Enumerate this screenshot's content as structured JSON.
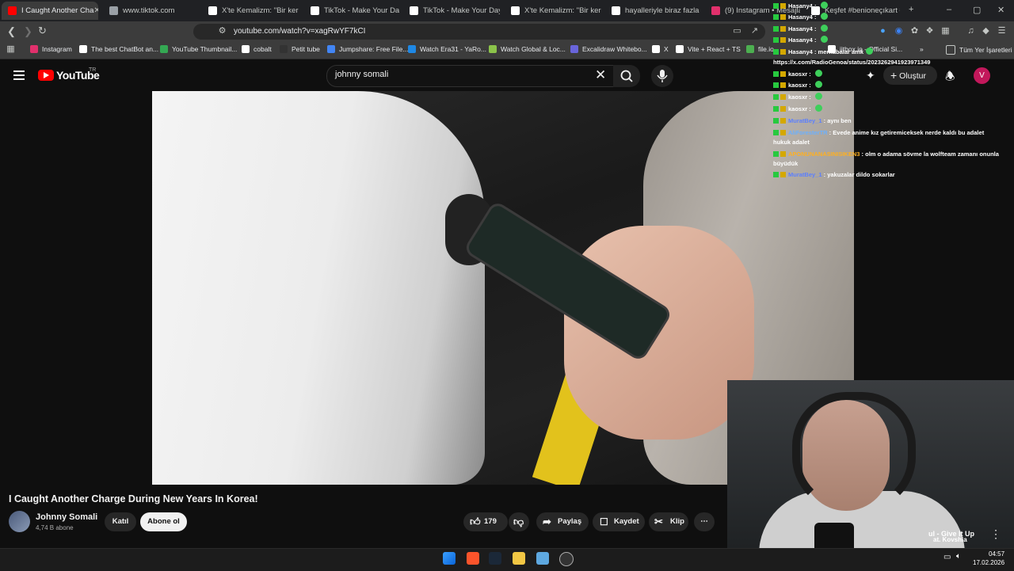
{
  "browser": {
    "tabs": [
      {
        "label": "I Caught Another Cha",
        "color": "#ff0000",
        "active": true
      },
      {
        "label": "www.tiktok.com",
        "color": "#9aa0a6"
      },
      {
        "label": "X'te Kemalizm: \"Bir kere d",
        "color": "#ffffff"
      },
      {
        "label": "TikTok - Make Your Day",
        "color": "#ffffff"
      },
      {
        "label": "TikTok - Make Your Day",
        "color": "#ffffff"
      },
      {
        "label": "X'te Kemalizm: \"Bir kere d",
        "color": "#ffffff"
      },
      {
        "label": "hayalleriyle biraz fazla oy",
        "color": "#ffffff"
      },
      {
        "label": "(9) Instagram • Mesajlar",
        "color": "#e1306c"
      },
      {
        "label": "Keşfet #benioneçıkart #k",
        "color": "#ffffff"
      }
    ],
    "new_tab": "+",
    "window_controls": [
      "–",
      "▢",
      "✕"
    ],
    "url": "youtube.com/watch?v=xagRwYF7kCI",
    "bookmarks": [
      {
        "label": "Instagram",
        "color": "#e1306c"
      },
      {
        "label": "The best ChatBot an...",
        "color": "#ffffff"
      },
      {
        "label": "YouTube Thumbnail...",
        "color": "#34a853"
      },
      {
        "label": "cobalt",
        "color": "#ffffff"
      },
      {
        "label": "Petit tube",
        "color": "#333333"
      },
      {
        "label": "Jumpshare: Free File...",
        "color": "#4285f4"
      },
      {
        "label": "Watch Era31 - YaRo...",
        "color": "#1e88e5"
      },
      {
        "label": "Watch Global & Loc...",
        "color": "#8bc34a"
      },
      {
        "label": "Excalidraw Whitebo...",
        "color": "#6965db"
      },
      {
        "label": "X",
        "color": "#ffffff"
      },
      {
        "label": "Vite + React + TS",
        "color": "#ffffff"
      },
      {
        "label": "file.io",
        "color": "#4caf50"
      },
      {
        "label": "jitbox.io - Official Si...",
        "color": "#ffffff"
      }
    ],
    "more_bookmarks": "»",
    "all_bookmarks": "Tüm Yer İşaretleri"
  },
  "youtube": {
    "logo": "YouTube",
    "country": "TR",
    "search_value": "johnny somali",
    "create_label": "Oluştur",
    "avatar_letter": "V",
    "video_title": "I Caught Another Charge During New Years In Korea!",
    "channel_name": "Johnny Somali",
    "subscribers": "4,74 B abone",
    "join_label": "Katıl",
    "subscribe_label": "Abone ol",
    "likes": "179",
    "share_label": "Paylaş",
    "save_label": "Kaydet",
    "clip_label": "Klip"
  },
  "chat": {
    "lines": [
      {
        "user": "Hasany4",
        "msg": "",
        "ucolor": "#ffffff",
        "emote": true
      },
      {
        "user": "Hasany4",
        "msg": "",
        "ucolor": "#ffffff",
        "emote": true
      },
      {
        "user": "Hasany4",
        "msg": "",
        "ucolor": "#ffffff",
        "emote": true
      },
      {
        "user": "Hasany4",
        "msg": "",
        "ucolor": "#ffffff",
        "emote": true
      },
      {
        "user": "Hasany4",
        "msg": "merhabalar amk",
        "ucolor": "#ffffff",
        "emote": true
      },
      {
        "user": "",
        "msg": "https://x.com/RadioGenoa/status/2023262941923971349",
        "ucolor": "#ffffff",
        "emote": false
      },
      {
        "user": "kaosxr",
        "msg": "",
        "ucolor": "#ffffff",
        "emote": true
      },
      {
        "user": "kaosxr",
        "msg": "",
        "ucolor": "#ffffff",
        "emote": true
      },
      {
        "user": "kaosxr",
        "msg": "",
        "ucolor": "#ffffff",
        "emote": true
      },
      {
        "user": "kaosxr",
        "msg": "",
        "ucolor": "#ffffff",
        "emote": true
      },
      {
        "user": "MuratBey_1",
        "msg": "aynı ben",
        "ucolor": "#5b7fff",
        "emote": false
      },
      {
        "user": "AliForesterTR",
        "msg": "Evede anime kız getiremiceksek nerde kaldı bu adalet",
        "ucolor": "#6ab0ff",
        "emote": false
      },
      {
        "user": "",
        "msg": "hukuk adalet",
        "ucolor": "#ffffff",
        "emote": false
      },
      {
        "user": "APONUNANASINISIKEN3",
        "msg": "olm o adama sövme la wolfteam zamanı onunla",
        "ucolor": "#ffb020",
        "emote": false
      },
      {
        "user": "",
        "msg": "büyüdük",
        "ucolor": "#ffffff",
        "emote": false
      },
      {
        "user": "MuratBey_1",
        "msg": "yakuzalar dildo sokarlar",
        "ucolor": "#5b7fff",
        "emote": false
      }
    ]
  },
  "music_overlay": {
    "line1": "ul - Give It Up",
    "line2": "at. Kovshia"
  },
  "taskbar": {
    "time": "04:57",
    "date": "17.02.2026"
  }
}
